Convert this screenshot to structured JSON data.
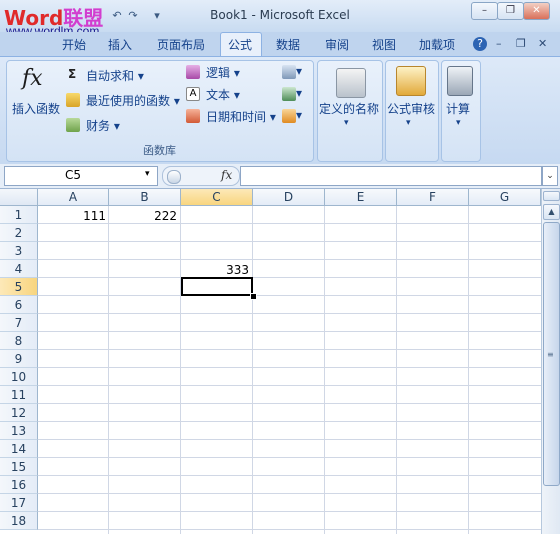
{
  "window": {
    "title": "Book1 - Microsoft Excel",
    "minimize": "–",
    "restore": "❐",
    "close": "✕"
  },
  "watermark": {
    "brand_w": "Word",
    "brand_l": "联盟",
    "url": "www.wordlm.com"
  },
  "qat": {
    "undo": "↶",
    "redo": "↷",
    "customize": "▾"
  },
  "tabs": [
    "开始",
    "插入",
    "页面布局",
    "公式",
    "数据",
    "审阅",
    "视图",
    "加载项"
  ],
  "active_tab": "公式",
  "ribbon_controls": {
    "help": "?",
    "min": "–",
    "restore": "❐",
    "close": "✕"
  },
  "ribbon": {
    "insert_function": "插入函数",
    "fx_glyph": "fx",
    "autosum": "自动求和",
    "recent": "最近使用的函数",
    "financial": "财务",
    "logical": "逻辑",
    "text": "文本",
    "datetime": "日期和时间",
    "group_label": "函数库",
    "defined_names": "定义的名称",
    "formula_auditing": "公式审核",
    "calculation": "计算",
    "sigma": "Σ",
    "dropdown": "▾"
  },
  "formula_bar": {
    "name_box": "C5",
    "fx": "fx",
    "content": ""
  },
  "columns": [
    "A",
    "B",
    "C",
    "D",
    "E",
    "F",
    "G"
  ],
  "rows": [
    "1",
    "2",
    "3",
    "4",
    "5",
    "6",
    "7",
    "8",
    "9",
    "10",
    "11",
    "12",
    "13",
    "14",
    "15",
    "16",
    "17",
    "18"
  ],
  "cells": {
    "A1": "111",
    "B1": "222",
    "C4": "333"
  },
  "selected_cell": "C5",
  "scroll": {
    "up": "▲",
    "down": "▼"
  },
  "colors": {
    "tab_active_bg": "#e8f0fb",
    "selection_header": "#f8d57f",
    "ribbon_text": "#15428b"
  }
}
